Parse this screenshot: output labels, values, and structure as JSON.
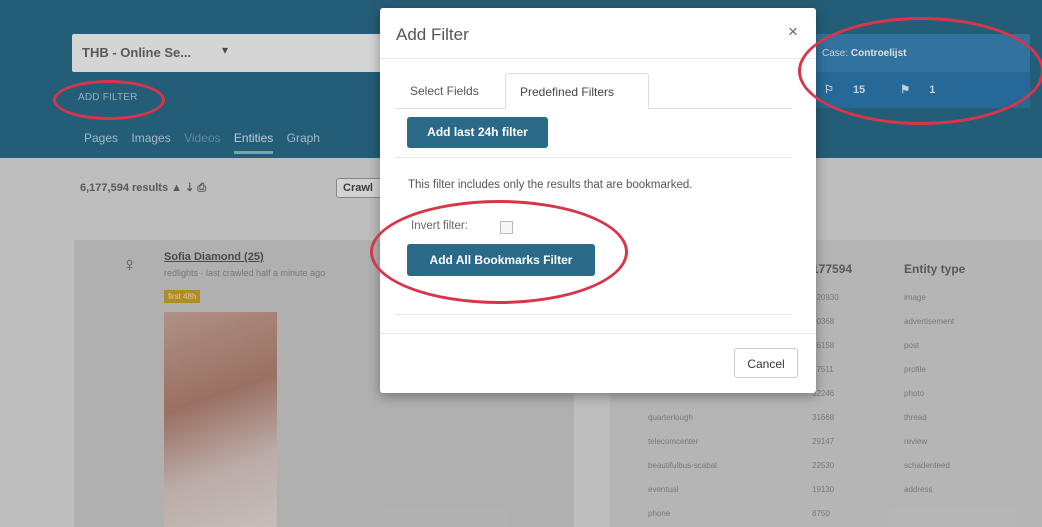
{
  "app": {
    "case_dropdown": "THB - Online Se...",
    "add_filter_link": "ADD FILTER",
    "nav_tabs": [
      "Pages",
      "Images",
      "Videos",
      "Entities",
      "Graph"
    ],
    "case_panel": {
      "prefix": "Case: ",
      "name": "Controelijst",
      "count_a": "15",
      "count_b": "1"
    },
    "results": {
      "count": "6,177,594 results",
      "crawl_button": "Crawl"
    },
    "result_item": {
      "name": "Sofia Diamond (25)",
      "subtitle": "redlights · last crawled half a minute ago",
      "badge": "first 48h"
    },
    "table": {
      "headers": [
        "177594",
        "Entity type"
      ],
      "rows": [
        [
          "",
          "320930",
          "image"
        ],
        [
          "",
          "30368",
          "advertisement"
        ],
        [
          "",
          "16158",
          "post"
        ],
        [
          "",
          "17511",
          "profile"
        ],
        [
          "",
          "32246",
          "photo"
        ],
        [
          "quarterlough",
          "31668",
          "thread"
        ],
        [
          "telecomcenter",
          "29147",
          "review"
        ],
        [
          "beautifulbus-scabal",
          "22530",
          "schadenfeed"
        ],
        [
          "eventual",
          "19130",
          "address"
        ],
        [
          "phone",
          "8750",
          ""
        ]
      ]
    }
  },
  "modal": {
    "title": "Add Filter",
    "close": "×",
    "tabs": [
      "Select Fields",
      "Predefined Filters"
    ],
    "btn_24h": "Add last 24h filter",
    "description": "This filter includes only the results that are bookmarked.",
    "invert_label": "Invert filter:",
    "invert_checked": false,
    "btn_bookmarks": "Add All Bookmarks Filter",
    "cancel": "Cancel"
  },
  "colors": {
    "header": "#2a6a88",
    "primary_button": "#2a6a88",
    "annotation": "#d8354a"
  }
}
